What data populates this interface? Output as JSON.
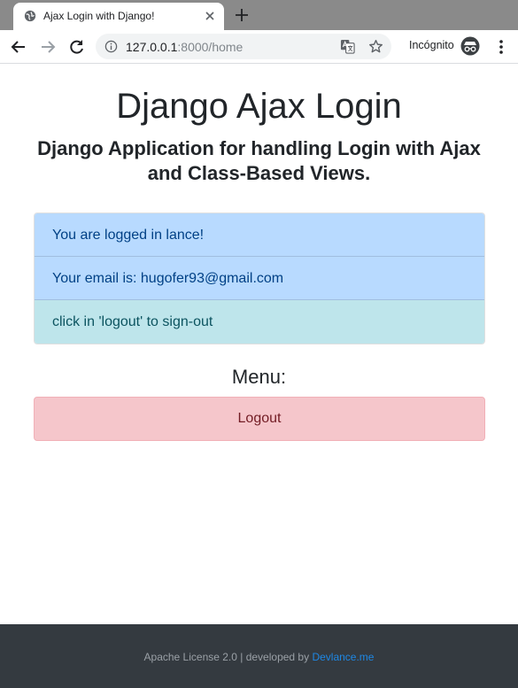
{
  "browser": {
    "tab_title": "Ajax Login with Django!",
    "url_host": "127.0.0.1",
    "url_path": ":8000/home",
    "incognito_label": "Incógnito",
    "icons": {
      "favicon": "globe-icon",
      "close": "close-icon",
      "new_tab": "plus-icon",
      "back": "back-arrow-icon",
      "forward": "forward-arrow-icon",
      "reload": "reload-icon",
      "info": "info-icon",
      "translate": "translate-icon",
      "bookmark": "star-icon",
      "incognito": "incognito-icon",
      "menu": "kebab-menu-icon"
    }
  },
  "page": {
    "title": "Django Ajax Login",
    "subtitle": "Django Application for handling Login with Ajax and Class-Based Views.",
    "info_items": [
      {
        "text": "You are logged in lance!",
        "variant": "primary"
      },
      {
        "text": "Your email is: hugofer93@gmail.com",
        "variant": "primary"
      },
      {
        "text": "click in 'logout' to sign-out",
        "variant": "info"
      }
    ],
    "menu_heading": "Menu:",
    "logout_label": "Logout"
  },
  "footer": {
    "text": "Apache License 2.0 | developed by ",
    "link_text": "Devlance.me"
  },
  "colors": {
    "primary_bg": "#b8daff",
    "info_bg": "#bee5eb",
    "danger_bg": "#f5c6cb",
    "footer_bg": "#343a40",
    "link": "#1e88e5"
  }
}
